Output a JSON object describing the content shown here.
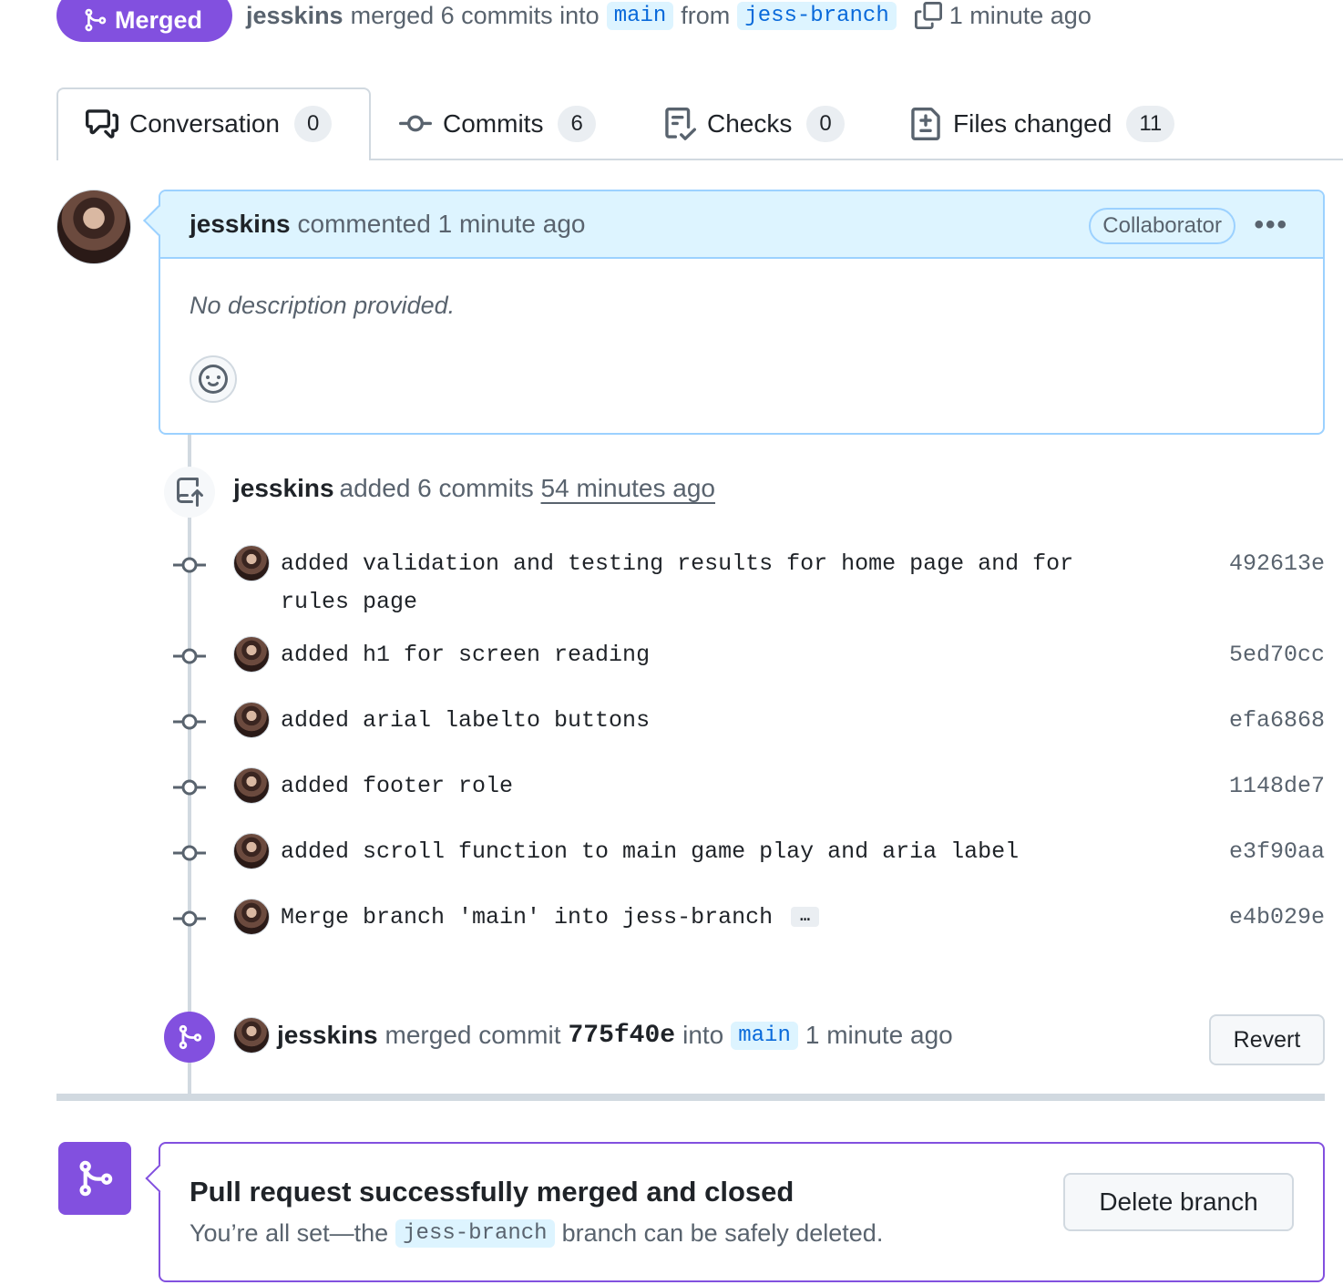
{
  "header": {
    "status_label": "Merged",
    "author": "jesskins",
    "summary": "merged 6 commits into",
    "base_branch": "main",
    "from_text": "from",
    "head_branch": "jess-branch",
    "time": "1 minute ago"
  },
  "tabs": [
    {
      "label": "Conversation",
      "count": "0"
    },
    {
      "label": "Commits",
      "count": "6"
    },
    {
      "label": "Checks",
      "count": "0"
    },
    {
      "label": "Files changed",
      "count": "11"
    }
  ],
  "comment": {
    "author": "jesskins",
    "action": "commented 1 minute ago",
    "role_badge": "Collaborator",
    "menu": "•••",
    "body": "No description provided."
  },
  "commits_event": {
    "author": "jesskins",
    "action": "added 6 commits",
    "time": "54 minutes ago"
  },
  "commits": [
    {
      "message": "added validation and testing results for home page and for rules page",
      "sha": "492613e"
    },
    {
      "message": "added h1 for screen reading",
      "sha": "5ed70cc"
    },
    {
      "message": "added arial labelto buttons",
      "sha": "efa6868"
    },
    {
      "message": "added footer role",
      "sha": "1148de7"
    },
    {
      "message": "added scroll function to main game play and aria label",
      "sha": "e3f90aa"
    },
    {
      "message": "Merge branch 'main' into jess-branch",
      "sha": "e4b029e",
      "expand": "…"
    }
  ],
  "merge_event": {
    "author": "jesskins",
    "action": "merged commit",
    "sha": "775f40e",
    "into": "into",
    "branch": "main",
    "time": "1 minute ago",
    "revert_label": "Revert"
  },
  "merged_box": {
    "title": "Pull request successfully merged and closed",
    "sub_before": "You’re all set—the",
    "branch": "jess-branch",
    "sub_after": "branch can be safely deleted.",
    "delete_label": "Delete branch"
  },
  "colors": {
    "merged_purple": "#8250df",
    "branch_bg": "#ddf4ff",
    "branch_fg": "#0969da"
  }
}
